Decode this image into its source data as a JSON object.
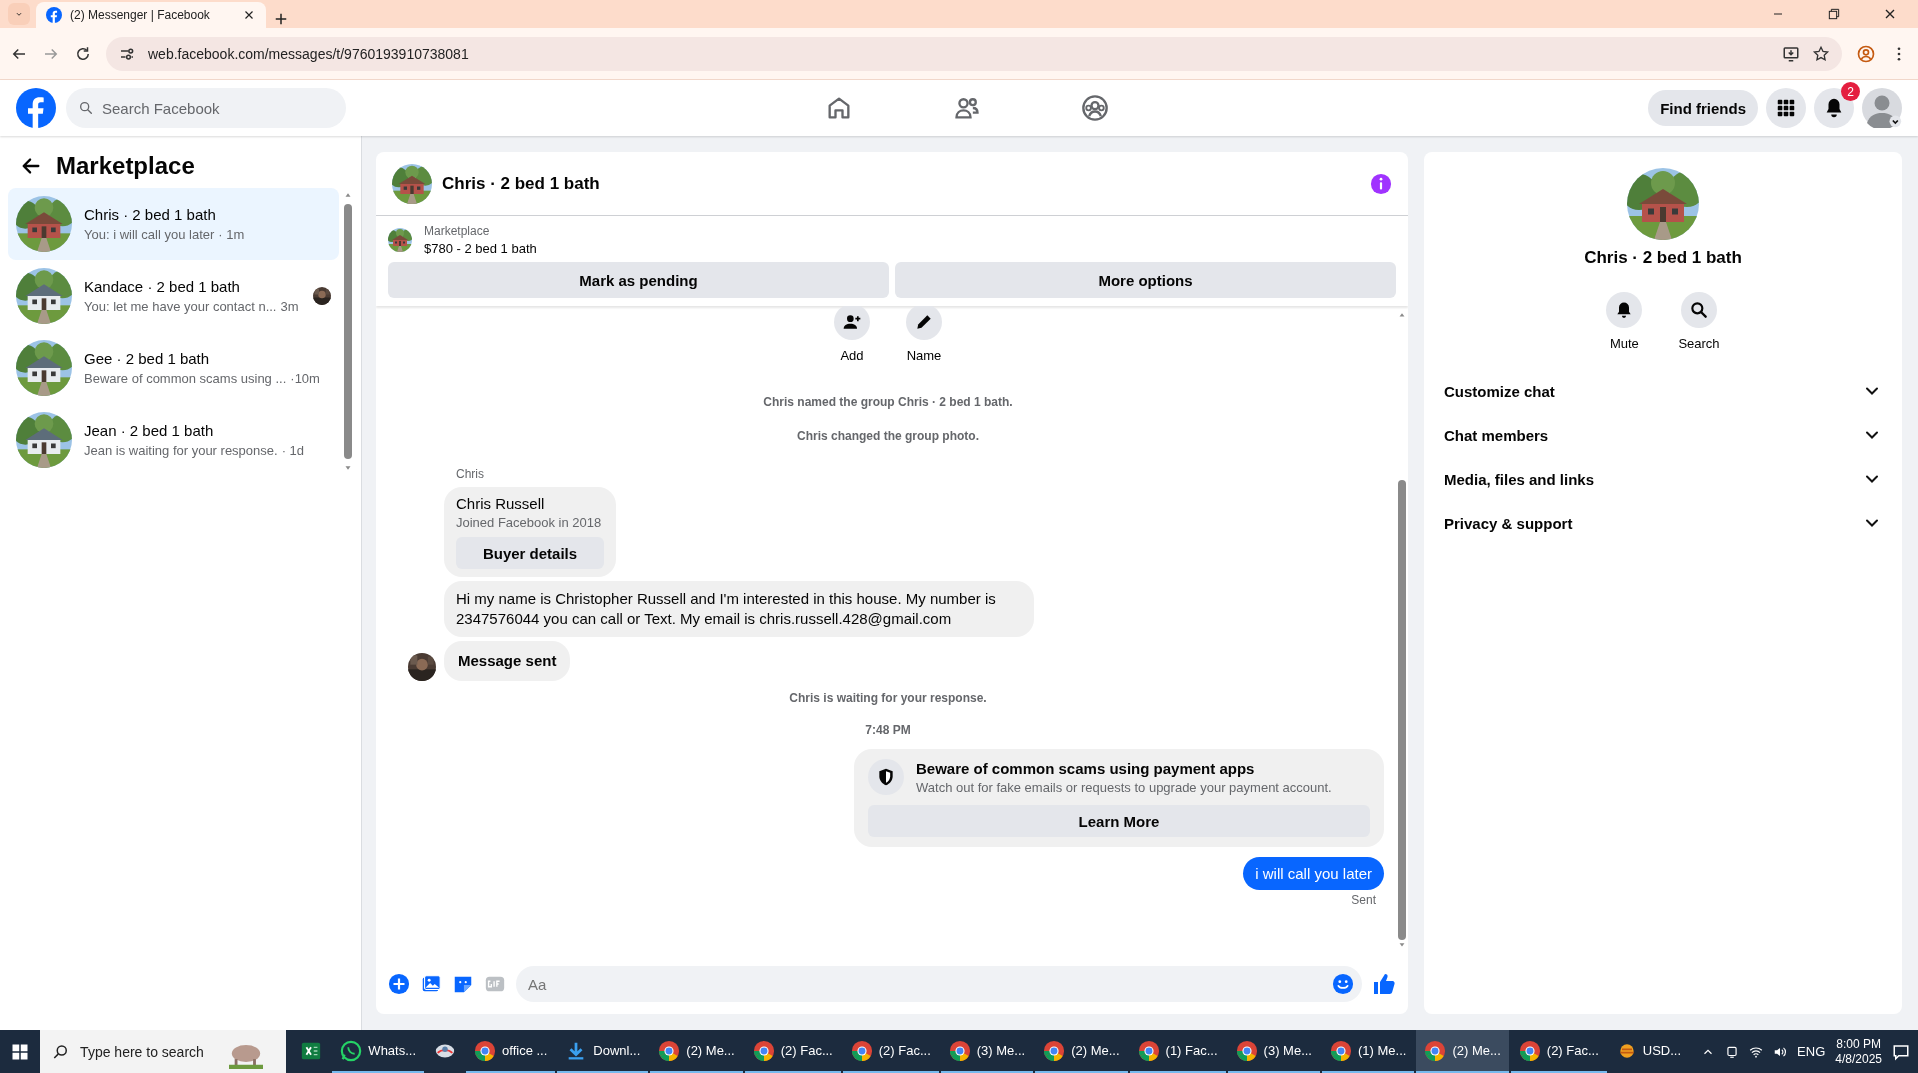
{
  "browser": {
    "tabs": [
      {
        "title": "(2) Messenger | Facebook",
        "selected": true
      }
    ],
    "url": "web.facebook.com/messages/t/9760193910738081"
  },
  "header": {
    "search_placeholder": "Search Facebook",
    "find_friends": "Find friends",
    "notification_count": "2"
  },
  "sidebar": {
    "title": "Marketplace",
    "conversations": [
      {
        "name": "Chris · 2 bed 1 bath",
        "preview": "You: i will call you later",
        "time": "· 1m",
        "selected": true,
        "seen": false
      },
      {
        "name": "Kandace · 2 bed 1 bath",
        "preview": "You: let me have your contact n...",
        "time": "3m",
        "selected": false,
        "seen": true
      },
      {
        "name": "Gee · 2 bed 1 bath",
        "preview": "Beware of common scams using ...",
        "time": "·10m",
        "selected": false,
        "seen": false
      },
      {
        "name": "Jean · 2 bed 1 bath",
        "preview": "Jean is waiting for your response.",
        "time": "· 1d",
        "selected": false,
        "seen": false
      }
    ]
  },
  "chat": {
    "title": "Chris · 2 bed 1 bath",
    "listing": {
      "label": "Marketplace",
      "title": "$780 - 2 bed 1 bath"
    },
    "actions": [
      "Mark as pending",
      "More options"
    ],
    "quick_actions": [
      {
        "kind": "add",
        "label": "Add"
      },
      {
        "kind": "name",
        "label": "Name"
      }
    ],
    "messages": [
      {
        "kind": "event",
        "text": "Chris named the group Chris · 2 bed 1 bath."
      },
      {
        "kind": "event",
        "text": "Chris changed the group photo."
      },
      {
        "kind": "sender",
        "text": "Chris"
      },
      {
        "kind": "profile",
        "name": "Chris Russell",
        "subtitle": "Joined Facebook in 2018",
        "button": "Buyer details"
      },
      {
        "kind": "incoming",
        "text": "Hi my name is Christopher Russell and I'm interested in this house. My number is 2347576044 you can call or Text. My email is chris.russell.428@gmail.com"
      },
      {
        "kind": "incoming_bold",
        "text": "Message sent"
      },
      {
        "kind": "event",
        "text": "Chris is waiting for your response."
      },
      {
        "kind": "time",
        "text": "7:48 PM"
      },
      {
        "kind": "notice",
        "title": "Beware of common scams using payment apps",
        "text": "Watch out for fake emails or requests to upgrade your payment account.",
        "button": "Learn More"
      },
      {
        "kind": "outgoing",
        "text": "i will call you later"
      },
      {
        "kind": "status",
        "text": "Sent"
      }
    ],
    "composer_placeholder": "Aa"
  },
  "details": {
    "name": "Chris · 2 bed 1 bath",
    "actions": [
      {
        "kind": "mute",
        "label": "Mute"
      },
      {
        "kind": "search",
        "label": "Search"
      }
    ],
    "sections": [
      {
        "label": "Customize chat",
        "expanded": false
      },
      {
        "label": "Chat members",
        "expanded": false
      },
      {
        "label": "Media, files and links",
        "expanded": false
      },
      {
        "label": "Privacy & support",
        "expanded": false
      }
    ]
  },
  "taskbar": {
    "search_placeholder": "Type here to search",
    "apps": [
      {
        "kind": "excel",
        "selected": false
      },
      {
        "kind": "whatsapp",
        "label": "Whats...",
        "selected": false
      },
      {
        "kind": "app",
        "selected": false
      },
      {
        "kind": "chrome",
        "label": "office ...",
        "selected": false
      },
      {
        "kind": "download",
        "label": "Downl...",
        "selected": false
      },
      {
        "kind": "chrome",
        "label": "(2) Me...",
        "selected": false
      },
      {
        "kind": "chrome",
        "label": "(2) Fac...",
        "selected": false
      },
      {
        "kind": "chrome",
        "label": "(2) Fac...",
        "selected": false
      },
      {
        "kind": "chrome",
        "label": "(3) Me...",
        "selected": false
      },
      {
        "kind": "chrome",
        "label": "(2) Me...",
        "selected": false
      },
      {
        "kind": "chrome",
        "label": "(1) Fac...",
        "selected": false
      },
      {
        "kind": "chrome",
        "label": "(3) Me...",
        "selected": false
      },
      {
        "kind": "chrome",
        "label": "(1) Me...",
        "selected": false
      },
      {
        "kind": "chrome",
        "label": "(2) Me...",
        "selected": true
      },
      {
        "kind": "chrome",
        "label": "(2) Fac...",
        "selected": false
      }
    ],
    "weather": "USD...",
    "language": "ENG",
    "time": "8:00 PM",
    "date": "4/8/2025"
  }
}
